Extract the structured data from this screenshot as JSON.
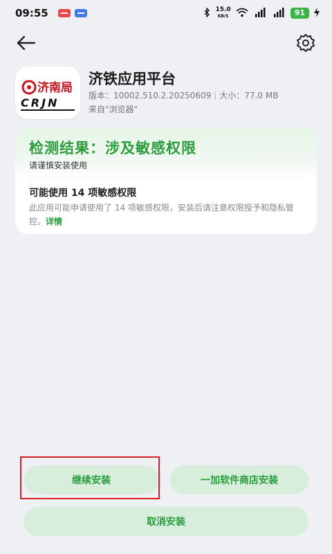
{
  "status_bar": {
    "time": "09:55",
    "network_speed_value": "15.0",
    "network_speed_unit": "KB/S",
    "battery": "91",
    "icons": [
      "notification-red-icon",
      "notification-blue-icon",
      "bluetooth-icon",
      "wifi-icon",
      "signal-5g-icon",
      "signal-5g-icon",
      "charging-icon"
    ]
  },
  "app": {
    "name": "济铁应用平台",
    "version_label": "版本：",
    "version": "10002.510.2.20250609",
    "size_label": "大小：",
    "size": "77.0 MB",
    "source": "来自\"浏览器\"",
    "logo_text": "济南局",
    "logo_sub": "CRJN"
  },
  "result": {
    "title": "检测结果：涉及敏感权限",
    "subtitle": "请谨慎安装使用",
    "permissions_title": "可能使用 14 项敏感权限",
    "permissions_desc": "此应用可能申请使用了 14 项敏感权限，安装后请注意权限授予和隐私管控。",
    "details_link": "详情"
  },
  "buttons": {
    "continue_install": "继续安装",
    "store_install": "一加软件商店安装",
    "cancel_install": "取消安装"
  },
  "colors": {
    "accent_green": "#2a9c3c",
    "button_bg": "#d8eedd",
    "highlight_red": "#d42020",
    "logo_red": "#c8141e",
    "background": "#eef0f3"
  }
}
